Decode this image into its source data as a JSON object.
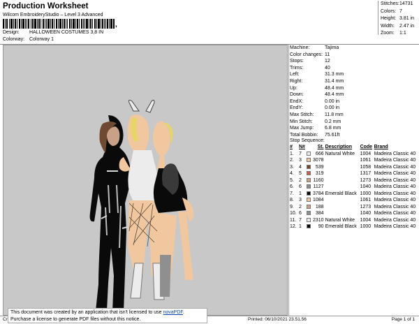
{
  "header": {
    "title": "Production Worksheet",
    "subtitle": "Wilcom EmbroideryStudio – Level 3 Advanced",
    "barcode_suffix": ",",
    "design_label": "Design:",
    "design_value": "HALLOWEEN COSTUMES 3,8 IN",
    "colorway_label": "Colorway:",
    "colorway_value": "Colorway 1"
  },
  "stats": [
    {
      "label": "Stitches:",
      "value": "14731"
    },
    {
      "label": "Colors:",
      "value": "7"
    },
    {
      "label": "Height:",
      "value": "3.81 in"
    },
    {
      "label": "Width:",
      "value": "2.47 in"
    },
    {
      "label": "Zoom:",
      "value": "1:1"
    }
  ],
  "machine_info": [
    {
      "label": "Machine:",
      "value": "Tajima"
    },
    {
      "label": "Color changes:",
      "value": "11"
    },
    {
      "label": "Stops:",
      "value": "12"
    },
    {
      "label": "Trims:",
      "value": "40"
    },
    {
      "label": "Left:",
      "value": "31.3 mm"
    },
    {
      "label": "Right:",
      "value": "31.4 mm"
    },
    {
      "label": "Up:",
      "value": "48.4 mm"
    },
    {
      "label": "Down:",
      "value": "48.4 mm"
    },
    {
      "label": "EndX:",
      "value": "0.00 in"
    },
    {
      "label": "EndY:",
      "value": "0.00 in"
    },
    {
      "label": "Max Stitch:",
      "value": "11.8 mm"
    },
    {
      "label": "Min Stitch:",
      "value": "0.2 mm"
    },
    {
      "label": "Max Jump:",
      "value": "6.8 mm"
    },
    {
      "label": "Total Bobbin:",
      "value": "75.61ft"
    }
  ],
  "stop_sequence": {
    "title": "Stop Sequence:",
    "headers": {
      "num": "#",
      "n": "N#",
      "st": "St.",
      "desc": "Description",
      "code": "Code",
      "brand": "Brand"
    },
    "rows": [
      {
        "num": "1.",
        "n": "7",
        "color": "#ececec",
        "st": "666",
        "desc": "Natural White",
        "code": "1004",
        "brand": "Madeira Classic 40"
      },
      {
        "num": "2.",
        "n": "3",
        "color": "#f1c79f",
        "st": "3078",
        "desc": "",
        "code": "1061",
        "brand": "Madeira Classic 40"
      },
      {
        "num": "3.",
        "n": "4",
        "color": "#6e4a33",
        "st": "539",
        "desc": "",
        "code": "1058",
        "brand": "Madeira Classic 40"
      },
      {
        "num": "4.",
        "n": "5",
        "color": "#c95f52",
        "st": "319",
        "desc": "",
        "code": "1317",
        "brand": "Madeira Classic 40"
      },
      {
        "num": "5.",
        "n": "2",
        "color": "#c9a186",
        "st": "1160",
        "desc": "",
        "code": "1273",
        "brand": "Madeira Classic 40"
      },
      {
        "num": "6.",
        "n": "6",
        "color": "#8f8f8f",
        "st": "1127",
        "desc": "",
        "code": "1040",
        "brand": "Madeira Classic 40"
      },
      {
        "num": "7.",
        "n": "1",
        "color": "#0a0a0a",
        "st": "3784",
        "desc": "Emerald Black",
        "code": "1000",
        "brand": "Madeira Classic 40"
      },
      {
        "num": "8.",
        "n": "3",
        "color": "#f1c79f",
        "st": "1084",
        "desc": "",
        "code": "1061",
        "brand": "Madeira Classic 40"
      },
      {
        "num": "9.",
        "n": "2",
        "color": "#c9a186",
        "st": "188",
        "desc": "",
        "code": "1273",
        "brand": "Madeira Classic 40"
      },
      {
        "num": "10.",
        "n": "6",
        "color": "#8f8f8f",
        "st": "384",
        "desc": "",
        "code": "1040",
        "brand": "Madeira Classic 40"
      },
      {
        "num": "11.",
        "n": "7",
        "color": "#ececec",
        "st": "2310",
        "desc": "Natural White",
        "code": "1004",
        "brand": "Madeira Classic 40"
      },
      {
        "num": "12.",
        "n": "1",
        "color": "#0a0a0a",
        "st": "90",
        "desc": "Emerald Black",
        "code": "1000",
        "brand": "Madeira Classic 40"
      }
    ]
  },
  "footer": {
    "left": "Cr",
    "printed": "Printed: 06/10/2021 23.51.56",
    "page": "Page 1 of 1"
  },
  "notice": {
    "line1_prefix": "This document was created by an application that isn't licensed to use ",
    "link": "novaPDF",
    "line1_suffix": ".",
    "line2": "Purchase a license to generate PDF files without this notice."
  }
}
